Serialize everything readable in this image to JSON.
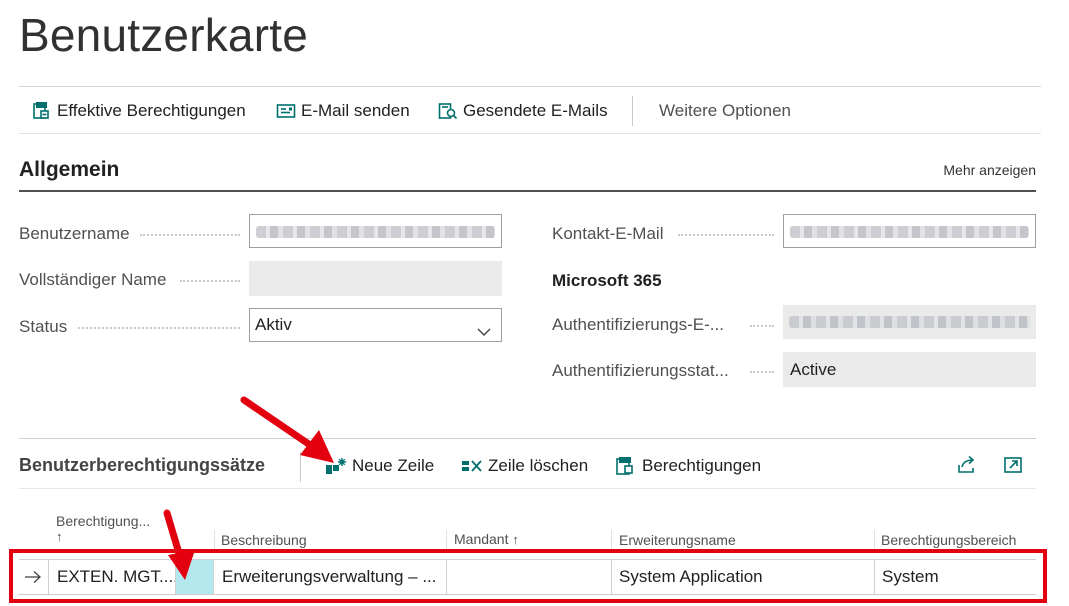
{
  "page": {
    "title": "Benutzerkarte"
  },
  "actions": {
    "effective_permissions": "Effektive Berechtigungen",
    "send_email": "E-Mail senden",
    "sent_emails": "Gesendete E-Mails",
    "more_options": "Weitere Optionen"
  },
  "general": {
    "title": "Allgemein",
    "show_more": "Mehr anzeigen",
    "username_label": "Benutzername",
    "fullname_label": "Vollständiger Name",
    "status_label": "Status",
    "status_value": "Aktiv",
    "contact_email_label": "Kontakt-E-Mail",
    "m365_heading": "Microsoft 365",
    "auth_email_label": "Authentifizierungs-E-...",
    "auth_status_label": "Authentifizierungsstat...",
    "auth_status_value": "Active"
  },
  "lines": {
    "title": "Benutzerberechtigungssätze",
    "new_line": "Neue Zeile",
    "delete_line": "Zeile löschen",
    "permissions": "Berechtigungen",
    "columns": {
      "permission_set": "Berechtigung...",
      "description": "Beschreibung",
      "company": "Mandant",
      "extension_name": "Erweiterungsname",
      "scope": "Berechtigungsbereich"
    },
    "rows": [
      {
        "permission_set": "EXTEN. MGT....",
        "description": "Erweiterungsverwaltung – ...",
        "company": "",
        "extension_name": "System Application",
        "scope": "System"
      }
    ]
  },
  "colors": {
    "annotation_red": "#e3000f",
    "accent_teal": "#008489",
    "selected_cell": "#b2e8ee"
  },
  "icons": [
    "effective-permissions-icon",
    "email-icon",
    "sent-emails-icon",
    "new-line-icon",
    "delete-line-icon",
    "permissions-icon",
    "share-icon",
    "expand-icon",
    "chevron-down-icon",
    "row-arrow-icon",
    "sort-up-icon",
    "red-arrow-annotation"
  ]
}
